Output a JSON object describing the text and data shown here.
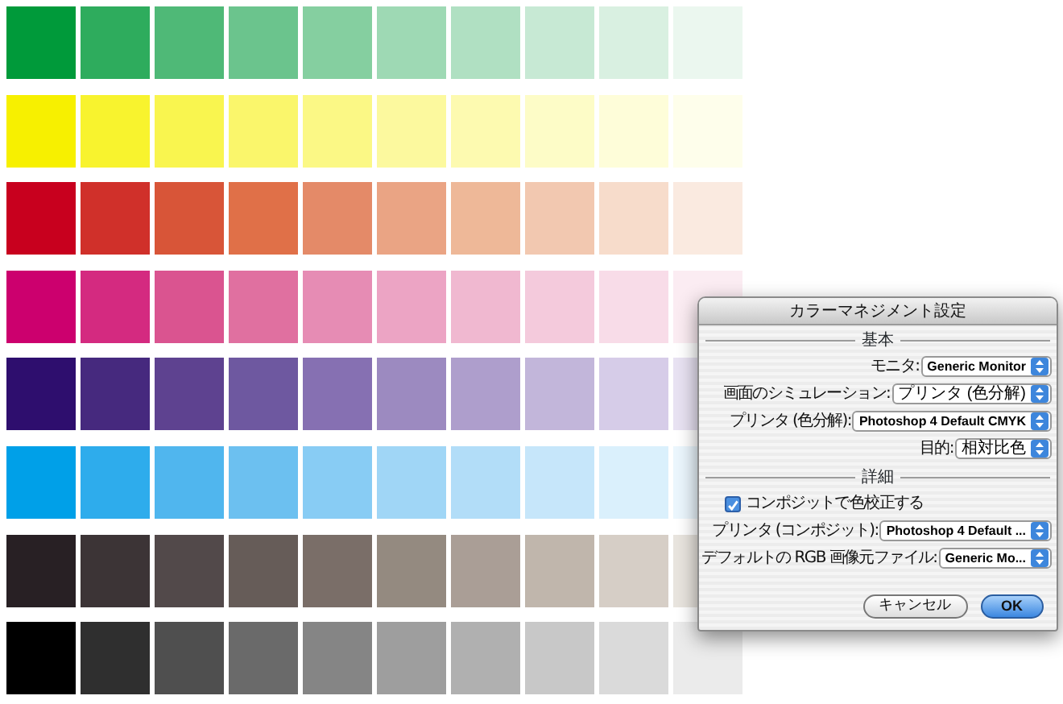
{
  "swatch_rows": [
    {
      "swatches": [
        {
          "color": "#009a3a"
        },
        {
          "color": "#2eac5d"
        },
        {
          "color": "#4fb977"
        },
        {
          "color": "#6bc48d"
        },
        {
          "color": "#85cfa0"
        },
        {
          "color": "#9ed9b4"
        },
        {
          "color": "#b0e0c2"
        },
        {
          "color": "#c7e9d4"
        },
        {
          "color": "#d9f0e1"
        },
        {
          "color": "#ebf7ef"
        }
      ]
    },
    {
      "swatches": [
        {
          "color": "#f7f000"
        },
        {
          "color": "#f8f32e"
        },
        {
          "color": "#f9f54f"
        },
        {
          "color": "#faf66b"
        },
        {
          "color": "#fbf885"
        },
        {
          "color": "#fcf99e"
        },
        {
          "color": "#fdfab0"
        },
        {
          "color": "#fdfcc7"
        },
        {
          "color": "#fefdd9"
        },
        {
          "color": "#fefeeb"
        }
      ]
    },
    {
      "swatches": [
        {
          "color": "#c8001e"
        },
        {
          "color": "#d0302a"
        },
        {
          "color": "#d85538"
        },
        {
          "color": "#e07048"
        },
        {
          "color": "#e48a68"
        },
        {
          "color": "#eaa484"
        },
        {
          "color": "#eeb898"
        },
        {
          "color": "#f2c8b0"
        },
        {
          "color": "#f7dccb"
        },
        {
          "color": "#faeae0"
        }
      ]
    },
    {
      "swatches": [
        {
          "color": "#cc006e"
        },
        {
          "color": "#d42a80"
        },
        {
          "color": "#da5490"
        },
        {
          "color": "#e070a0"
        },
        {
          "color": "#e68cb4"
        },
        {
          "color": "#eca4c4"
        },
        {
          "color": "#f0b8d0"
        },
        {
          "color": "#f4cadc"
        },
        {
          "color": "#f8dce8"
        },
        {
          "color": "#fbecf2"
        }
      ]
    },
    {
      "swatches": [
        {
          "color": "#2e0e6e"
        },
        {
          "color": "#46297e"
        },
        {
          "color": "#5e4290"
        },
        {
          "color": "#6e58a0"
        },
        {
          "color": "#8670b2"
        },
        {
          "color": "#9c8ac0"
        },
        {
          "color": "#ae9ecc"
        },
        {
          "color": "#c2b6da"
        },
        {
          "color": "#d6cce8"
        },
        {
          "color": "#e8e2f2"
        }
      ]
    },
    {
      "swatches": [
        {
          "color": "#00a0e8"
        },
        {
          "color": "#2eacec"
        },
        {
          "color": "#50b6ee"
        },
        {
          "color": "#6cc0f0"
        },
        {
          "color": "#88ccf4"
        },
        {
          "color": "#a0d6f6"
        },
        {
          "color": "#b2ddf8"
        },
        {
          "color": "#c6e6fa"
        },
        {
          "color": "#daf0fc"
        },
        {
          "color": "#ebf6fd"
        }
      ]
    },
    {
      "swatches": [
        {
          "color": "#282024"
        },
        {
          "color": "#3c3436"
        },
        {
          "color": "#52494a"
        },
        {
          "color": "#665c58"
        },
        {
          "color": "#7a6e68"
        },
        {
          "color": "#948a80"
        },
        {
          "color": "#aa9e96"
        },
        {
          "color": "#c0b6ac"
        },
        {
          "color": "#d6cec6"
        },
        {
          "color": "#e8e4de"
        }
      ]
    },
    {
      "swatches": [
        {
          "color": "#000000"
        },
        {
          "color": "#2f2f2f"
        },
        {
          "color": "#4f4f4f"
        },
        {
          "color": "#6a6a6a"
        },
        {
          "color": "#858585"
        },
        {
          "color": "#9e9e9e"
        },
        {
          "color": "#b0b0b0"
        },
        {
          "color": "#c8c8c8"
        },
        {
          "color": "#dadada"
        },
        {
          "color": "#ebebeb"
        }
      ]
    }
  ],
  "dialog": {
    "title": "カラーマネジメント設定",
    "sections": [
      {
        "heading": "基本",
        "rows": [
          {
            "kind": "select",
            "label": "モニタ:",
            "value": "Generic Monitor"
          },
          {
            "kind": "select",
            "label": "画面のシミュレーション:",
            "value": "プリンタ (色分解)"
          },
          {
            "kind": "select",
            "label": "プリンタ (色分解):",
            "value": "Photoshop 4 Default CMYK"
          },
          {
            "kind": "select",
            "label": "目的:",
            "value": "相対比色"
          }
        ]
      },
      {
        "heading": "詳細",
        "rows": [
          {
            "kind": "checkbox",
            "label": "コンポジットで色校正する",
            "checked": true
          },
          {
            "kind": "select",
            "label": "プリンタ (コンポジット):",
            "value": "Photoshop 4 Default ..."
          },
          {
            "kind": "select",
            "label": "デフォルトの RGB 画像元ファイル:",
            "value": "Generic Mo..."
          }
        ]
      }
    ],
    "buttons": [
      {
        "label": "キャンセル",
        "default": false
      },
      {
        "label": "OK",
        "default": true
      }
    ]
  }
}
